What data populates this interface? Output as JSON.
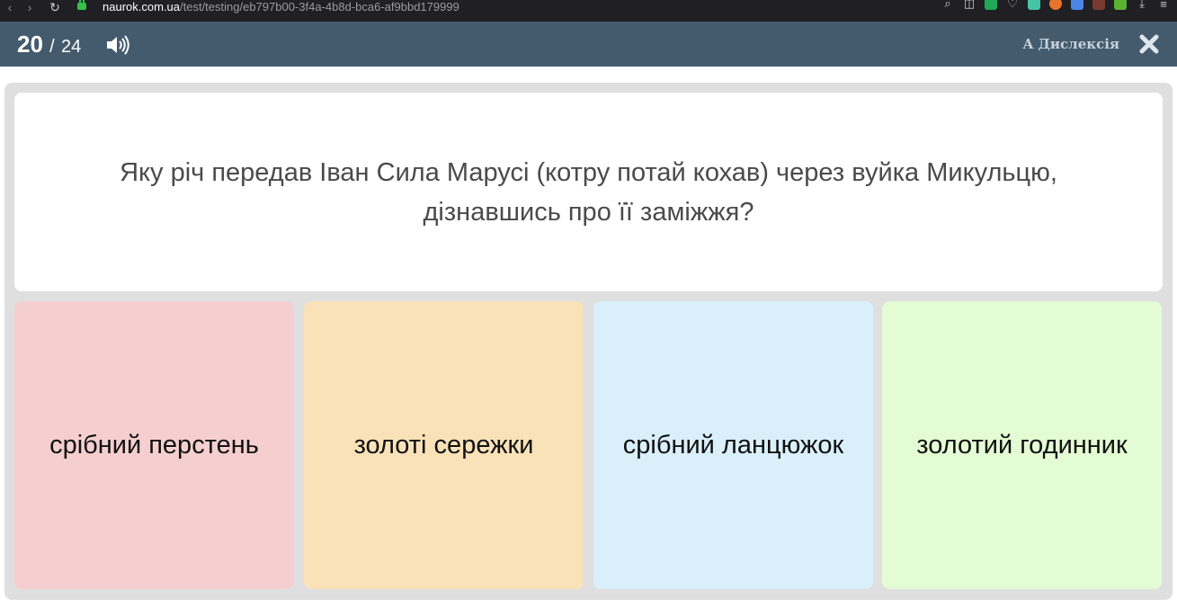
{
  "browser": {
    "url_host": "naurok.com.ua",
    "url_path": "/test/testing/eb797b00-3f4a-4b8d-bca6-af9bbd179999"
  },
  "header": {
    "current_question": "20",
    "separator": "/",
    "total_questions": "24",
    "dyslexia_label": "Дислексія"
  },
  "question": {
    "text": "Яку річ передав Іван Сила Марусі (котру потай кохав) через вуйка Микульцю, дізнавшись про її заміжжя?"
  },
  "answers": [
    {
      "label": "срібний перстень",
      "color": "#f5cfcf"
    },
    {
      "label": "золоті сережки",
      "color": "#f9e2b8"
    },
    {
      "label": "срібний ланцюжок",
      "color": "#d9eff9"
    },
    {
      "label": "золотий годинник",
      "color": "#e3fcd4"
    }
  ],
  "colors": {
    "header_bg": "#445b6d",
    "stage_bg": "#dfdfdf"
  }
}
